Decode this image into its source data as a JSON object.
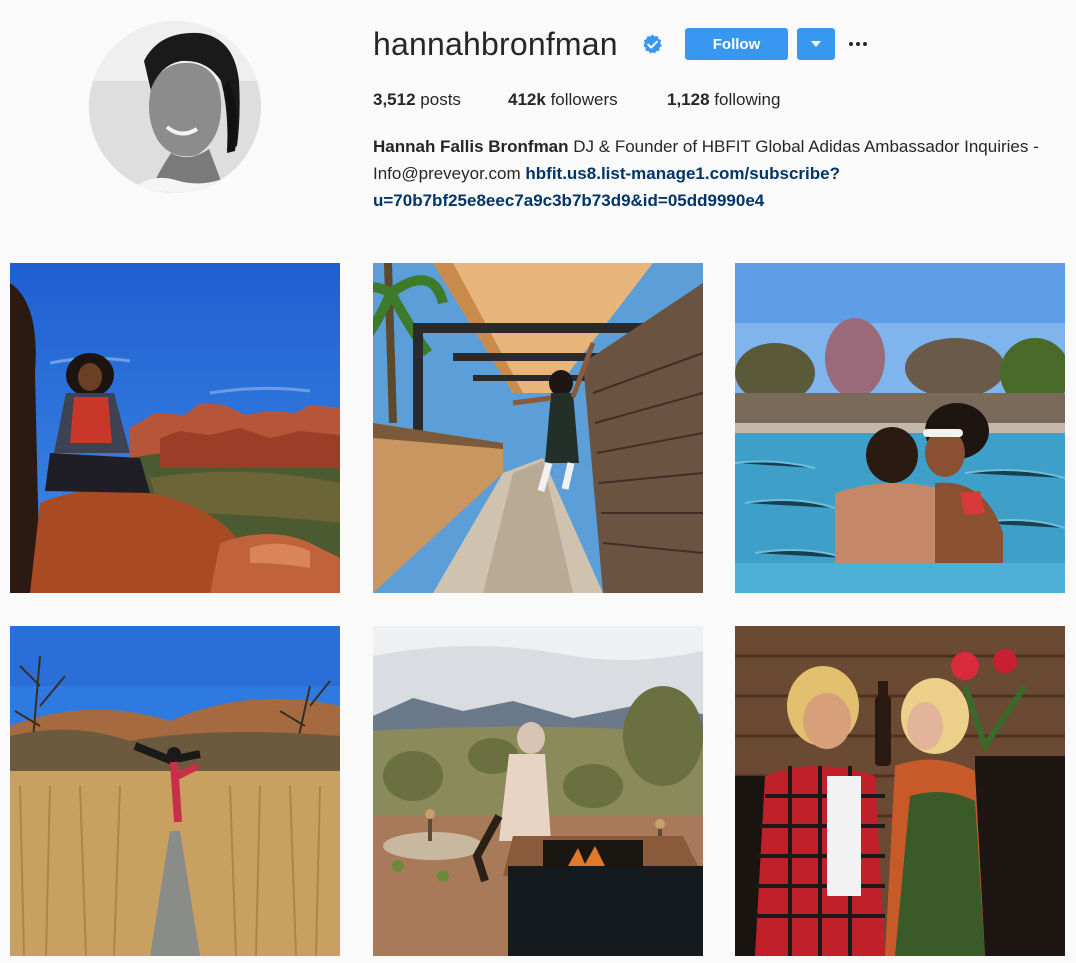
{
  "profile": {
    "username": "hannahbronfman",
    "verified": true,
    "follow_label": "Follow",
    "stats": {
      "posts_count": "3,512",
      "posts_label": "posts",
      "followers_count": "412k",
      "followers_label": "followers",
      "following_count": "1,128",
      "following_label": "following"
    },
    "bio": {
      "full_name": "Hannah Fallis Bronfman",
      "text": " DJ & Founder of HBFIT Global Adidas Ambassador Inquiries - Info@preveyor.com ",
      "link": "hbfit.us8.list-manage1.com/subscribe?u=70b7bf25e8eec7a9c3b7b73d9&id=05dd9990e4"
    }
  },
  "colors": {
    "accent": "#3897f0",
    "link": "#003569",
    "verified": "#3897f0"
  },
  "icons": {
    "verified": "verified-badge-icon",
    "dropdown": "chevron-down-icon",
    "more": "more-options-icon"
  }
}
